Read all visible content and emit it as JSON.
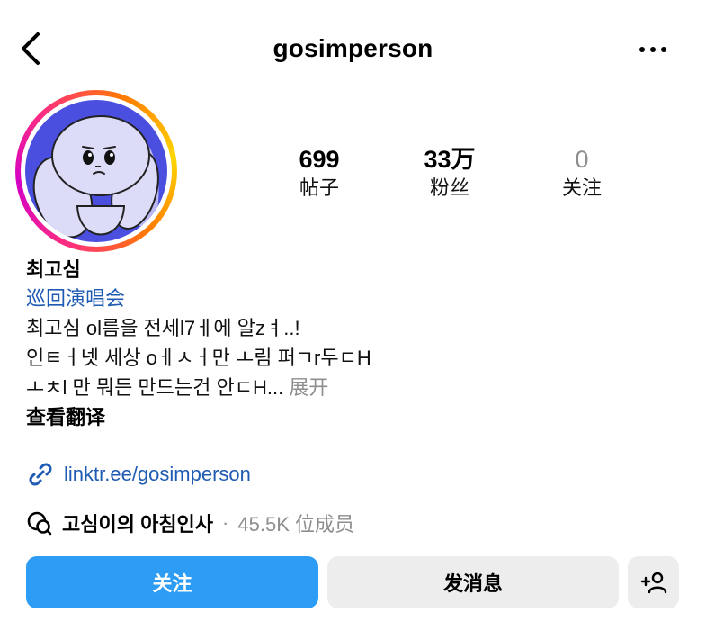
{
  "header": {
    "username": "gosimperson",
    "back_icon": "chevron-left-icon",
    "more_icon": "more-horizontal-icon"
  },
  "stats": {
    "posts": {
      "value": "699",
      "label": "帖子"
    },
    "followers": {
      "value": "33万",
      "label": "粉丝"
    },
    "following": {
      "value": "0",
      "label": "关注"
    }
  },
  "bio": {
    "display_name": "최고심",
    "category": "巡回演唱会",
    "lines": [
      "최고심 ol름을 전세l7ㅔ에 알zㅕ..!",
      "인ㅌㅓ넷 세상 oㅔㅅㅓ만 ㅗ림 퍼ㄱr두ㄷH",
      "ㅗㅊl 만 뭐든 만드는건 안ㄷH..."
    ],
    "more_label": "展开",
    "translate_label": "查看翻译"
  },
  "link": {
    "icon": "link-icon",
    "text": "linktr.ee/gosimperson"
  },
  "channel": {
    "icon": "broadcast-channel-icon",
    "name": "고심이의 아침인사",
    "separator": "·",
    "members": "45.5K 位成员"
  },
  "actions": {
    "follow_label": "关注",
    "message_label": "发消息",
    "suggest_icon": "add-person-icon"
  },
  "colors": {
    "link_blue": "#1f5bb3",
    "follow_button": "#2d9cf5",
    "secondary_button": "#ededed",
    "muted_text": "#8e8e8e",
    "avatar_background": "#4a4fe0"
  }
}
